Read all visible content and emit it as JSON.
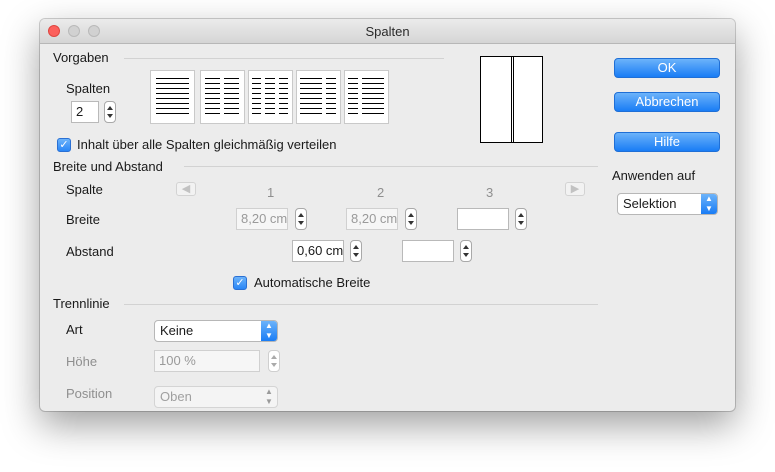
{
  "window": {
    "title": "Spalten"
  },
  "vorgaben": {
    "section_title": "Vorgaben",
    "spalten_label": "Spalten",
    "spalten_value": "2",
    "distribute_checkbox_label": "Inhalt über alle Spalten gleichmäßig verteilen",
    "distribute_checked": true
  },
  "breite_abstand": {
    "section_title": "Breite und Abstand",
    "spalte_label": "Spalte",
    "columns": [
      "1",
      "2",
      "3"
    ],
    "breite_label": "Breite",
    "breite_values": [
      "8,20 cm",
      "8,20 cm",
      ""
    ],
    "abstand_label": "Abstand",
    "abstand_values": [
      "0,60 cm",
      ""
    ],
    "auto_width_label": "Automatische Breite",
    "auto_width_checked": true
  },
  "trennlinie": {
    "section_title": "Trennlinie",
    "art_label": "Art",
    "art_value": "Keine",
    "hoehe_label": "Höhe",
    "hoehe_value": "100 %",
    "position_label": "Position",
    "position_value": "Oben"
  },
  "buttons": {
    "ok": "OK",
    "cancel": "Abbrechen",
    "help": "Hilfe"
  },
  "apply": {
    "label": "Anwenden auf",
    "value": "Selektion"
  },
  "icons": {
    "prev": "arrow-left-icon",
    "next": "arrow-right-icon",
    "stepper": "stepper-arrows-icon",
    "check": "checkmark-icon",
    "dropdown": "chevron-updown-icon"
  },
  "colors": {
    "accent": "#1a7cf5",
    "window_bg": "#ececec",
    "close": "#fc605c"
  }
}
